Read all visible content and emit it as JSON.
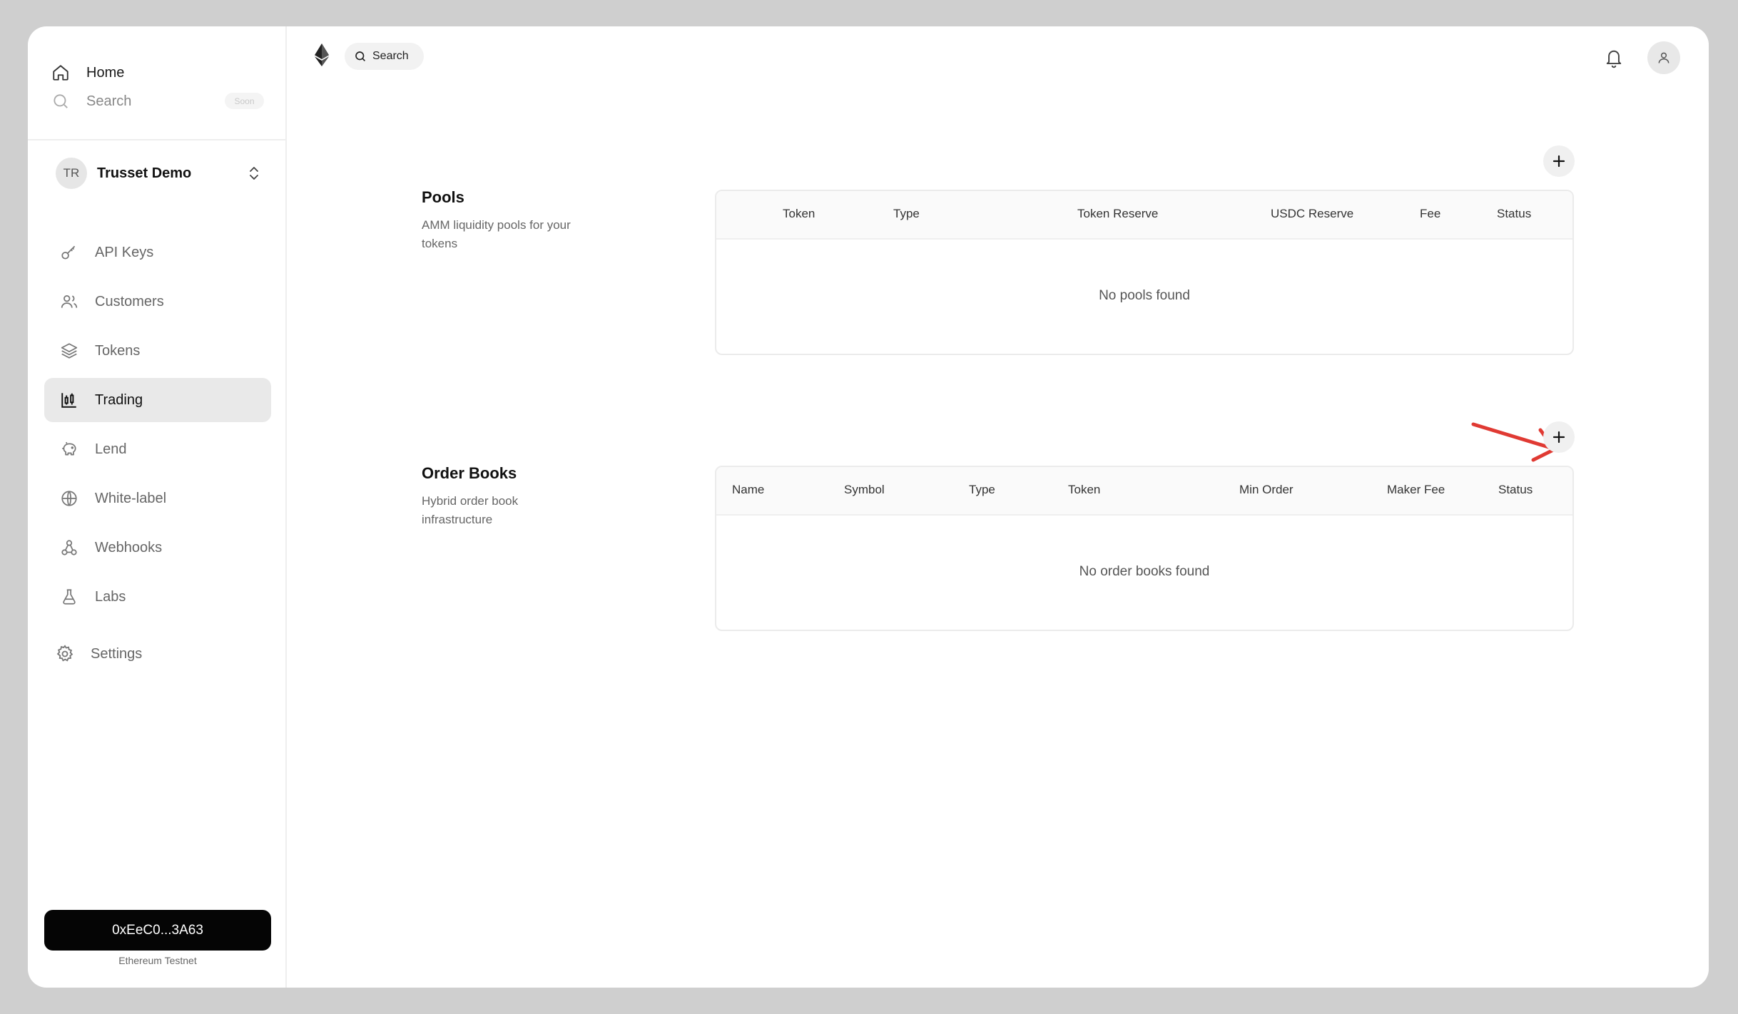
{
  "sidebar": {
    "home_label": "Home",
    "search_label": "Search",
    "soon_badge": "Soon",
    "workspace": {
      "initials": "TR",
      "name": "Trusset Demo"
    },
    "nav": {
      "api_keys": "API Keys",
      "customers": "Customers",
      "tokens": "Tokens",
      "trading": "Trading",
      "lend": "Lend",
      "white_label": "White-label",
      "webhooks": "Webhooks",
      "labs": "Labs",
      "settings": "Settings"
    },
    "wallet_address": "0xEeC0...3A63",
    "network": "Ethereum Testnet"
  },
  "topbar": {
    "search_label": "Search"
  },
  "pools": {
    "title": "Pools",
    "description": "AMM liquidity pools for your tokens",
    "columns": [
      "Token",
      "Type",
      "Token Reserve",
      "USDC Reserve",
      "Fee",
      "Status"
    ],
    "empty_message": "No pools found"
  },
  "order_books": {
    "title": "Order Books",
    "description": "Hybrid order book infrastructure",
    "columns": [
      "Name",
      "Symbol",
      "Type",
      "Token",
      "Min Order",
      "Maker Fee",
      "Status"
    ],
    "empty_message": "No order books found"
  },
  "colors": {
    "accent": "#050505",
    "active_nav_bg": "#e9e9e9",
    "annotation_arrow": "#e03a33"
  }
}
